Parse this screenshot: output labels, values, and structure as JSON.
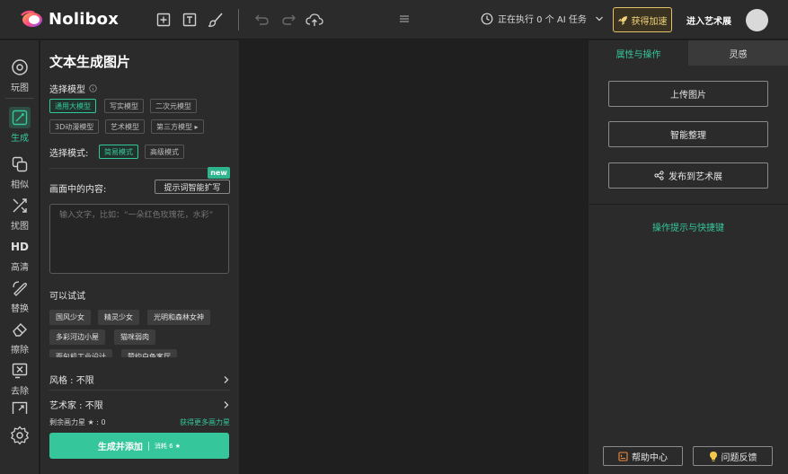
{
  "app": {
    "name": "Nolibox"
  },
  "topbar": {
    "ai_status": "正在执行 0 个 AI 任务",
    "speed_button": "获得加速",
    "gallery_link": "进入艺术展"
  },
  "nav": {
    "items": [
      {
        "label": "玩图",
        "icon": "palette-icon"
      },
      {
        "label": "生成",
        "icon": "pen-icon"
      },
      {
        "label": "相似",
        "icon": "copy-icon"
      },
      {
        "label": "扰图",
        "icon": "shuffle-icon"
      },
      {
        "label": "高清",
        "icon": "hd-icon"
      },
      {
        "label": "替换",
        "icon": "replace-icon"
      },
      {
        "label": "擦除",
        "icon": "eraser-icon"
      },
      {
        "label": "去除",
        "icon": "remove-icon"
      }
    ]
  },
  "panel": {
    "title": "文本生成图片",
    "model_label": "选择模型",
    "models": [
      "通用大模型",
      "写实模型",
      "二次元模型",
      "3D动漫模型",
      "艺术模型",
      "第三方模型 ▸"
    ],
    "selected_model": "通用大模型",
    "mode_label": "选择模式:",
    "modes": [
      "简易模式",
      "高级模式"
    ],
    "selected_mode": "简易模式",
    "content_label": "画面中的内容:",
    "expand_button": "提示词智能扩写",
    "new_badge": "new",
    "prompt_placeholder": "输入文字，比如：“一朵红色玫瑰花，水彩”",
    "try_label": "可以试试",
    "suggestions": [
      "国风少女",
      "精灵少女",
      "光明和森林女神",
      "多彩河边小屋",
      "猫咪弱肉",
      "面包机工业设计",
      "赞约白色客厅"
    ],
    "style_row": "风格 : 不限",
    "artist_row": "艺术家 : 不限",
    "points_label": "剩余画力星 ★ : 0",
    "points_more": "获得更多画力星",
    "generate_button": "生成并添加",
    "generate_cost": "消耗 6 ★"
  },
  "right": {
    "tabs": [
      "属性与操作",
      "灵感"
    ],
    "active_tab": "属性与操作",
    "buttons": [
      "上传图片",
      "智能整理",
      "发布到艺术展"
    ],
    "hint_link": "操作提示与快捷键",
    "help_button": "帮助中心",
    "feedback_button": "问题反馈"
  },
  "colors": {
    "accent": "#35c79b",
    "panel_bg": "#2b2b2b",
    "canvas_bg": "#1f1f1f",
    "gold": "#e3c26a"
  }
}
